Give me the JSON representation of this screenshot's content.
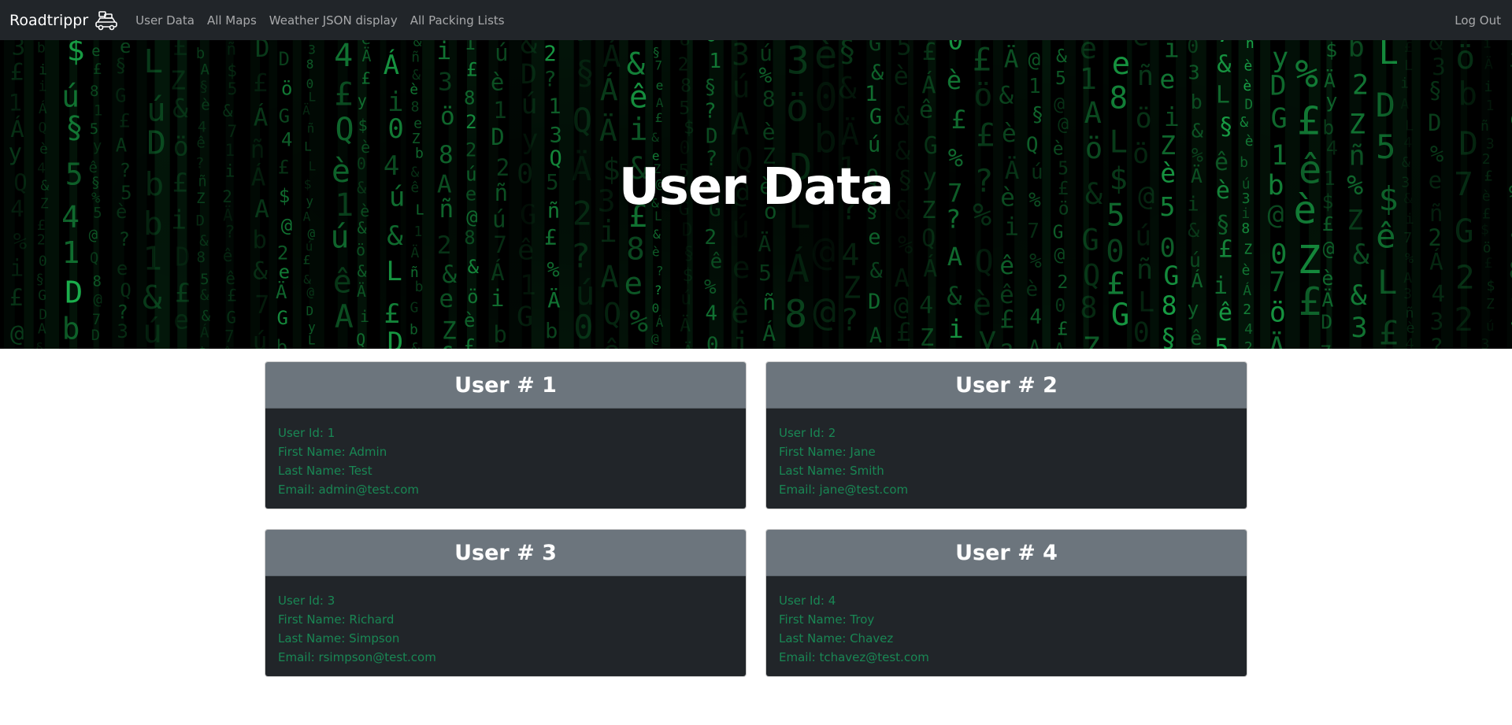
{
  "nav": {
    "brand": "Roadtrippr",
    "brand_icon": "car-with-luggage-icon",
    "links": [
      "User Data",
      "All Maps",
      "Weather JSON display",
      "All Packing Lists"
    ],
    "logout": "Log Out"
  },
  "hero": {
    "title": "User Data"
  },
  "cards": [
    {
      "header": "User # 1",
      "rows": [
        "User Id: 1",
        "First Name: Admin",
        "Last Name: Test",
        "Email: admin@test.com"
      ]
    },
    {
      "header": "User # 2",
      "rows": [
        "User Id: 2",
        "First Name: Jane",
        "Last Name: Smith",
        "Email: jane@test.com"
      ]
    },
    {
      "header": "User # 3",
      "rows": [
        "User Id: 3",
        "First Name: Richard",
        "Last Name: Simpson",
        "Email: rsimpson@test.com"
      ]
    },
    {
      "header": "User # 4",
      "rows": [
        "User Id: 4",
        "First Name: Troy",
        "Last Name: Chavez",
        "Email: tchavez@test.com"
      ]
    }
  ],
  "colors": {
    "navbar": "#212529",
    "card_header": "#6c757d",
    "card_body": "#212529",
    "card_text": "#198754",
    "matrix_green": "#1fcf5a"
  }
}
